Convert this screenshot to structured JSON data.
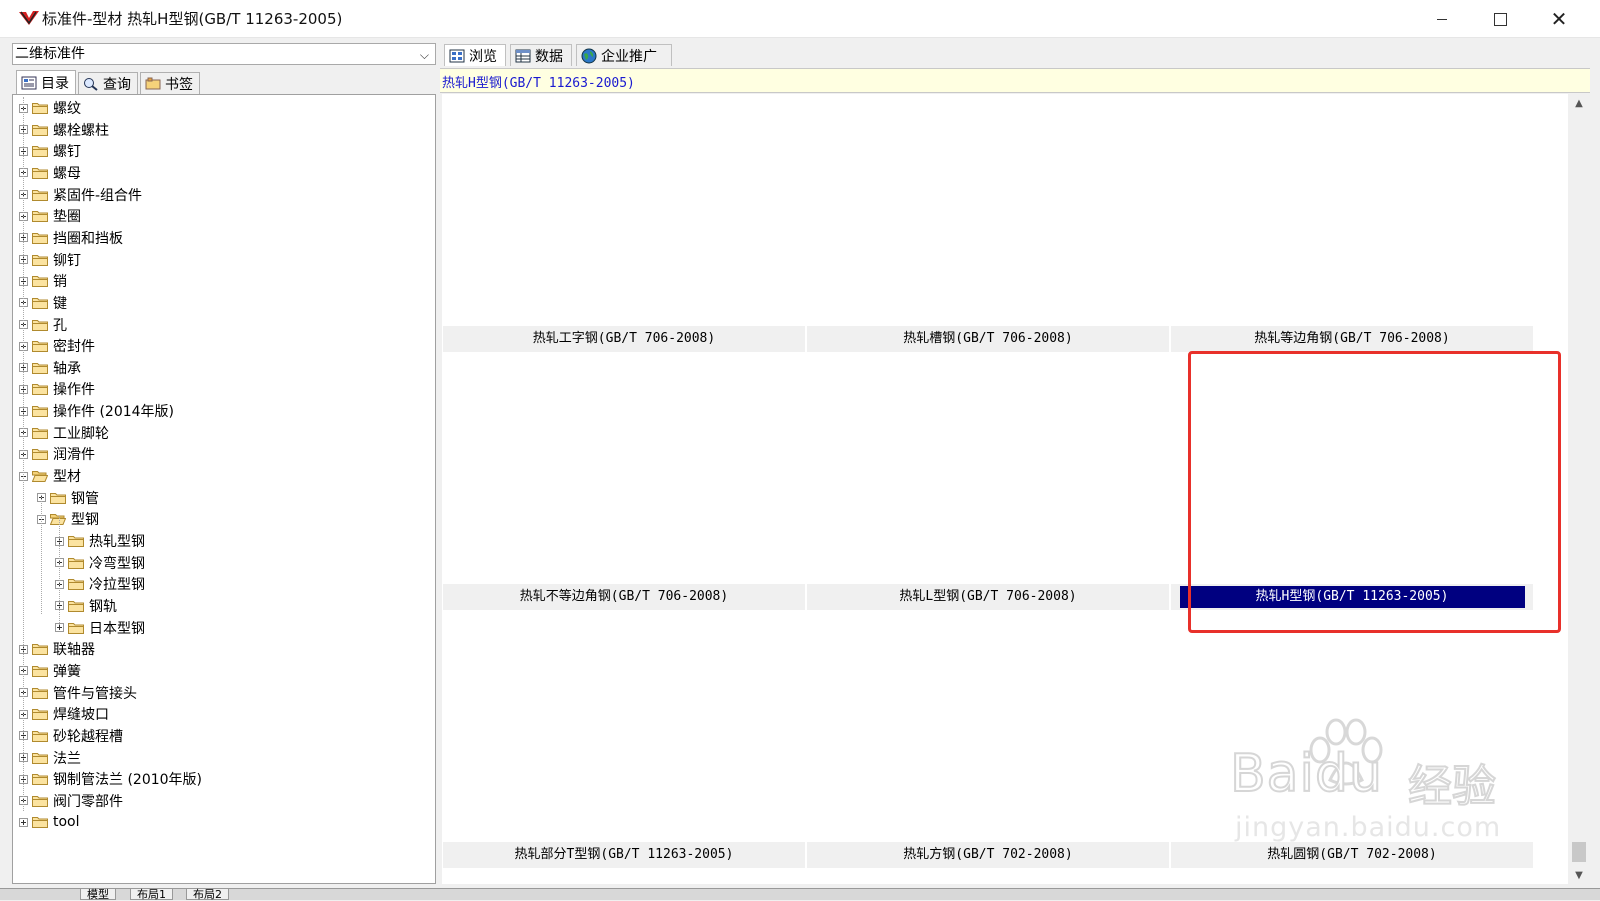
{
  "window": {
    "title": "标准件-型材 热轧H型钢(GB/T 11263-2005)",
    "minimize_icon": "minimize-icon",
    "maximize_icon": "maximize-icon",
    "close_icon": "close-icon"
  },
  "left": {
    "library_select": "二维标准件",
    "tabs": [
      {
        "label": "目录",
        "icon": "catalog-icon",
        "active": true
      },
      {
        "label": "查询",
        "icon": "search-icon",
        "active": false
      },
      {
        "label": "书签",
        "icon": "bookmark-icon",
        "active": false
      }
    ],
    "tree": [
      {
        "label": "螺纹",
        "level": 0,
        "expanded": false
      },
      {
        "label": "螺栓螺柱",
        "level": 0,
        "expanded": false
      },
      {
        "label": "螺钉",
        "level": 0,
        "expanded": false
      },
      {
        "label": "螺母",
        "level": 0,
        "expanded": false
      },
      {
        "label": "紧固件-组合件",
        "level": 0,
        "expanded": false
      },
      {
        "label": "垫圈",
        "level": 0,
        "expanded": false
      },
      {
        "label": "挡圈和挡板",
        "level": 0,
        "expanded": false
      },
      {
        "label": "铆钉",
        "level": 0,
        "expanded": false
      },
      {
        "label": "销",
        "level": 0,
        "expanded": false
      },
      {
        "label": "键",
        "level": 0,
        "expanded": false
      },
      {
        "label": "孔",
        "level": 0,
        "expanded": false
      },
      {
        "label": "密封件",
        "level": 0,
        "expanded": false
      },
      {
        "label": "轴承",
        "level": 0,
        "expanded": false
      },
      {
        "label": "操作件",
        "level": 0,
        "expanded": false
      },
      {
        "label": "操作件 (2014年版)",
        "level": 0,
        "expanded": false
      },
      {
        "label": "工业脚轮",
        "level": 0,
        "expanded": false
      },
      {
        "label": "润滑件",
        "level": 0,
        "expanded": false
      },
      {
        "label": "型材",
        "level": 0,
        "expanded": true
      },
      {
        "label": "钢管",
        "level": 1,
        "expanded": false
      },
      {
        "label": "型钢",
        "level": 1,
        "expanded": true
      },
      {
        "label": "热轧型钢",
        "level": 2,
        "expanded": false
      },
      {
        "label": "冷弯型钢",
        "level": 2,
        "expanded": false
      },
      {
        "label": "冷拉型钢",
        "level": 2,
        "expanded": false
      },
      {
        "label": "钢轨",
        "level": 2,
        "expanded": false
      },
      {
        "label": "日本型钢",
        "level": 2,
        "expanded": false
      },
      {
        "label": "联轴器",
        "level": 0,
        "expanded": false
      },
      {
        "label": "弹簧",
        "level": 0,
        "expanded": false
      },
      {
        "label": "管件与管接头",
        "level": 0,
        "expanded": false
      },
      {
        "label": "焊缝坡口",
        "level": 0,
        "expanded": false
      },
      {
        "label": "砂轮越程槽",
        "level": 0,
        "expanded": false
      },
      {
        "label": "法兰",
        "level": 0,
        "expanded": false
      },
      {
        "label": "钢制管法兰 (2010年版)",
        "level": 0,
        "expanded": false
      },
      {
        "label": "阀门零部件",
        "level": 0,
        "expanded": false
      },
      {
        "label": "tool",
        "level": 0,
        "expanded": false
      }
    ]
  },
  "right": {
    "tabs": [
      {
        "label": "浏览",
        "icon": "browse-icon",
        "active": true
      },
      {
        "label": "数据",
        "icon": "table-icon",
        "active": false
      },
      {
        "label": "企业推广",
        "icon": "globe-icon",
        "active": false
      }
    ],
    "breadcrumb": "热轧H型钢(GB/T 11263-2005)",
    "items": [
      {
        "label": "热轧工字钢(GB/T 706-2008)",
        "selected": false
      },
      {
        "label": "热轧槽钢(GB/T 706-2008)",
        "selected": false
      },
      {
        "label": "热轧等边角钢(GB/T 706-2008)",
        "selected": false
      },
      {
        "label": "热轧不等边角钢(GB/T 706-2008)",
        "selected": false
      },
      {
        "label": "热轧L型钢(GB/T 706-2008)",
        "selected": false
      },
      {
        "label": "热轧H型钢(GB/T 11263-2005)",
        "selected": true
      },
      {
        "label": "热轧部分T型钢(GB/T 11263-2005)",
        "selected": false
      },
      {
        "label": "热轧方钢(GB/T 702-2008)",
        "selected": false
      },
      {
        "label": "热轧圆钢(GB/T 702-2008)",
        "selected": false
      }
    ],
    "highlight_color": "#e8302a",
    "selection_color": "#000080"
  },
  "bottom_tabs": [
    "模型",
    "布局1",
    "布局2"
  ],
  "watermark": {
    "brand": "Baidu",
    "text": "经验",
    "url": "jingyan.baidu.com"
  }
}
